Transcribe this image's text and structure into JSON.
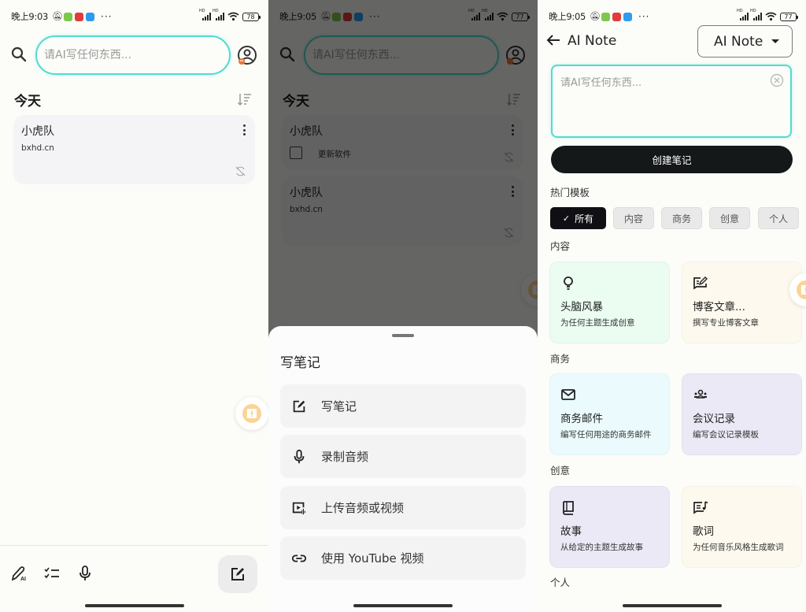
{
  "colors": {
    "accent_teal": "#4fdcd0",
    "create_button": "#151819",
    "card_green": "#ebfcf1",
    "card_cream": "#fdf9ee",
    "card_cyan": "#ebfbfd",
    "card_lavender": "#ebe9f6",
    "accessibility_orange": "#fbd394"
  },
  "screen1": {
    "status": {
      "time": "晚上9:03",
      "battery": "78"
    },
    "search": {
      "placeholder": "请AI写任何东西..."
    },
    "section_title": "今天",
    "notes": [
      {
        "title": "小虎队",
        "body": "bxhd.cn"
      }
    ],
    "bottom_bar": {
      "icons": [
        "ai-pen-icon",
        "checklist-icon",
        "microphone-icon"
      ],
      "fab_icon": "edit-note-icon"
    }
  },
  "screen2": {
    "status": {
      "time": "晚上9:05",
      "battery": "77"
    },
    "search": {
      "placeholder": "请AI写任何东西..."
    },
    "section_title": "今天",
    "notes": [
      {
        "title": "小虎队",
        "checklist_item": "更新软件",
        "checked": false
      },
      {
        "title": "小虎队",
        "body": "bxhd.cn"
      }
    ],
    "sheet": {
      "title": "写笔记",
      "items": [
        {
          "icon": "edit-icon",
          "label": "写笔记"
        },
        {
          "icon": "microphone-icon",
          "label": "录制音频"
        },
        {
          "icon": "upload-video-icon",
          "label": "上传音频或视频"
        },
        {
          "icon": "link-icon",
          "label": "使用 YouTube 视频"
        }
      ]
    }
  },
  "screen3": {
    "status": {
      "time": "晚上9:05",
      "battery": "77"
    },
    "title": "AI Note",
    "model_select": {
      "value": "AI Note"
    },
    "prompt": {
      "placeholder": "请AI写任何东西..."
    },
    "create_button": "创建笔记",
    "popular_label": "热门模板",
    "filters": [
      {
        "label": "所有",
        "active": true
      },
      {
        "label": "内容",
        "active": false
      },
      {
        "label": "商务",
        "active": false
      },
      {
        "label": "创意",
        "active": false
      },
      {
        "label": "个人",
        "active": false
      }
    ],
    "sections": [
      {
        "label": "内容",
        "templates": [
          {
            "icon": "lightbulb-icon",
            "title": "头脑风暴",
            "desc": "为任何主题生成创意"
          },
          {
            "icon": "blog-edit-icon",
            "title": "博客文章...",
            "desc": "撰写专业博客文章"
          }
        ]
      },
      {
        "label": "商务",
        "templates": [
          {
            "icon": "mail-icon",
            "title": "商务邮件",
            "desc": "编写任何用途的商务邮件"
          },
          {
            "icon": "group-icon",
            "title": "会议记录",
            "desc": "编写会议记录模板"
          }
        ]
      },
      {
        "label": "创意",
        "templates": [
          {
            "icon": "book-icon",
            "title": "故事",
            "desc": "从给定的主题生成故事"
          },
          {
            "icon": "lyrics-icon",
            "title": "歌词",
            "desc": "为任何音乐风格生成歌词"
          }
        ]
      },
      {
        "label": "个人",
        "templates": []
      }
    ]
  }
}
